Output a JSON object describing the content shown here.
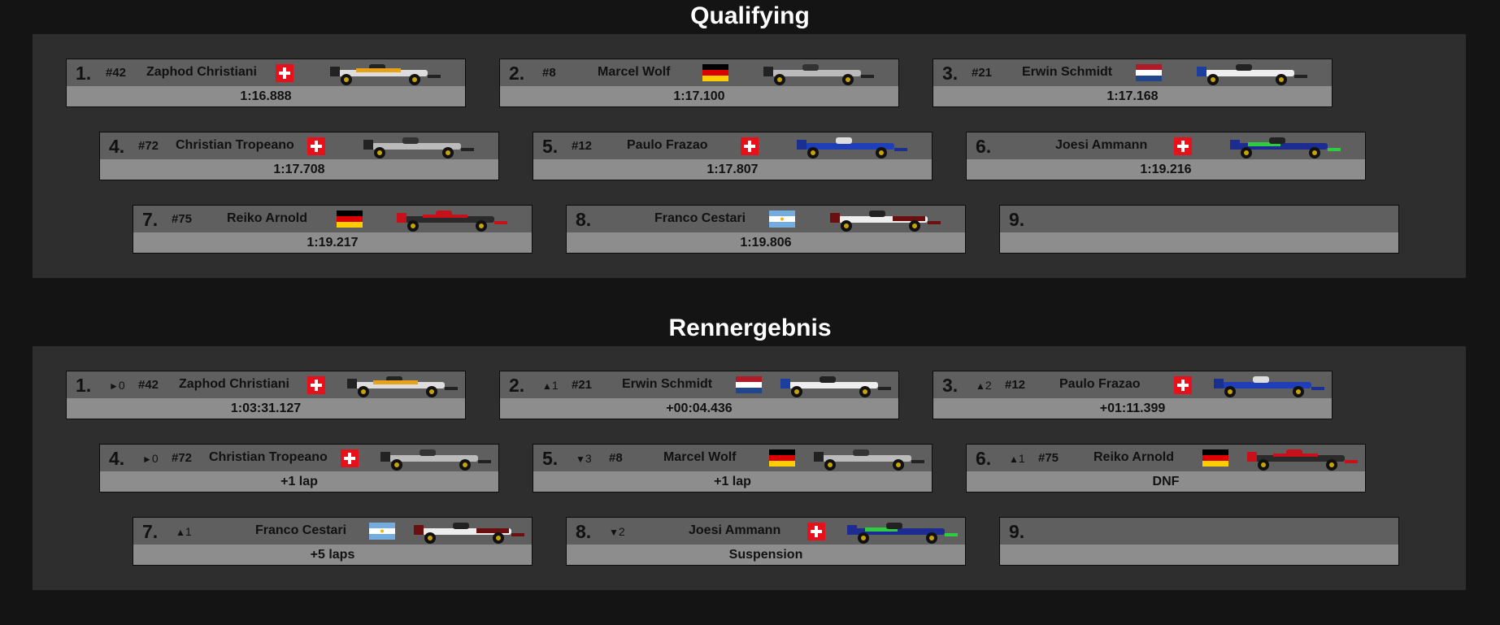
{
  "qualifying": {
    "title": "Qualifying",
    "results": [
      {
        "pos": "1.",
        "number": "#42",
        "driver": "Zaphod Christiani",
        "flag": "switzerland-flag-icon",
        "car": "yellow-livery-car-icon",
        "time": "1:16.888"
      },
      {
        "pos": "2.",
        "number": "#8",
        "driver": "Marcel Wolf",
        "flag": "germany-flag-icon",
        "car": "grey-livery-car-icon",
        "time": "1:17.100"
      },
      {
        "pos": "3.",
        "number": "#21",
        "driver": "Erwin Schmidt",
        "flag": "netherlands-flag-icon",
        "car": "white-blue-livery-car-icon",
        "time": "1:17.168"
      },
      {
        "pos": "4.",
        "number": "#72",
        "driver": "Christian Tropeano",
        "flag": "switzerland-flag-icon",
        "car": "grey-livery-car-icon",
        "time": "1:17.708"
      },
      {
        "pos": "5.",
        "number": "#12",
        "driver": "Paulo Frazao",
        "flag": "switzerland-flag-icon",
        "car": "blue-livery-car-icon",
        "time": "1:17.807"
      },
      {
        "pos": "6.",
        "number": "",
        "driver": "Joesi Ammann",
        "flag": "switzerland-flag-icon",
        "car": "blue-green-livery-car-icon",
        "time": "1:19.216"
      },
      {
        "pos": "7.",
        "number": "#75",
        "driver": "Reiko Arnold",
        "flag": "germany-flag-icon",
        "car": "red-black-livery-car-icon",
        "time": "1:19.217"
      },
      {
        "pos": "8.",
        "number": "",
        "driver": "Franco Cestari",
        "flag": "argentina-flag-icon",
        "car": "white-red-livery-car-icon",
        "time": "1:19.806"
      },
      {
        "pos": "9.",
        "number": "",
        "driver": "",
        "flag": "",
        "car": "",
        "time": ""
      }
    ]
  },
  "race": {
    "title": "Rennergebnis",
    "results": [
      {
        "pos": "1.",
        "arrow": "►",
        "change": "0",
        "number": "#42",
        "driver": "Zaphod Christiani",
        "flag": "switzerland-flag-icon",
        "car": "yellow-livery-car-icon",
        "time": "1:03:31.127"
      },
      {
        "pos": "2.",
        "arrow": "▲",
        "change": "1",
        "number": "#21",
        "driver": "Erwin Schmidt",
        "flag": "netherlands-flag-icon",
        "car": "white-blue-livery-car-icon",
        "time": "+00:04.436"
      },
      {
        "pos": "3.",
        "arrow": "▲",
        "change": "2",
        "number": "#12",
        "driver": "Paulo Frazao",
        "flag": "switzerland-flag-icon",
        "car": "blue-livery-car-icon",
        "time": "+01:11.399"
      },
      {
        "pos": "4.",
        "arrow": "►",
        "change": "0",
        "number": "#72",
        "driver": "Christian Tropeano",
        "flag": "switzerland-flag-icon",
        "car": "grey-livery-car-icon",
        "time": "+1 lap"
      },
      {
        "pos": "5.",
        "arrow": "▼",
        "change": "3",
        "number": "#8",
        "driver": "Marcel Wolf",
        "flag": "germany-flag-icon",
        "car": "grey-livery-car-icon",
        "time": "+1 lap"
      },
      {
        "pos": "6.",
        "arrow": "▲",
        "change": "1",
        "number": "#75",
        "driver": "Reiko Arnold",
        "flag": "germany-flag-icon",
        "car": "red-black-livery-car-icon",
        "time": "DNF"
      },
      {
        "pos": "7.",
        "arrow": "▲",
        "change": "1",
        "number": "",
        "driver": "Franco Cestari",
        "flag": "argentina-flag-icon",
        "car": "white-red-livery-car-icon",
        "time": "+5 laps"
      },
      {
        "pos": "8.",
        "arrow": "▼",
        "change": "2",
        "number": "",
        "driver": "Joesi Ammann",
        "flag": "switzerland-flag-icon",
        "car": "blue-green-livery-car-icon",
        "time": "Suspension"
      },
      {
        "pos": "9.",
        "arrow": "",
        "change": "",
        "number": "",
        "driver": "",
        "flag": "",
        "car": "",
        "time": ""
      }
    ]
  },
  "colors": {
    "page_background": "#141414",
    "panel_background": "#2e2e2e",
    "card_top": "#5f5f5f",
    "card_bottom": "#8d8d8d"
  }
}
